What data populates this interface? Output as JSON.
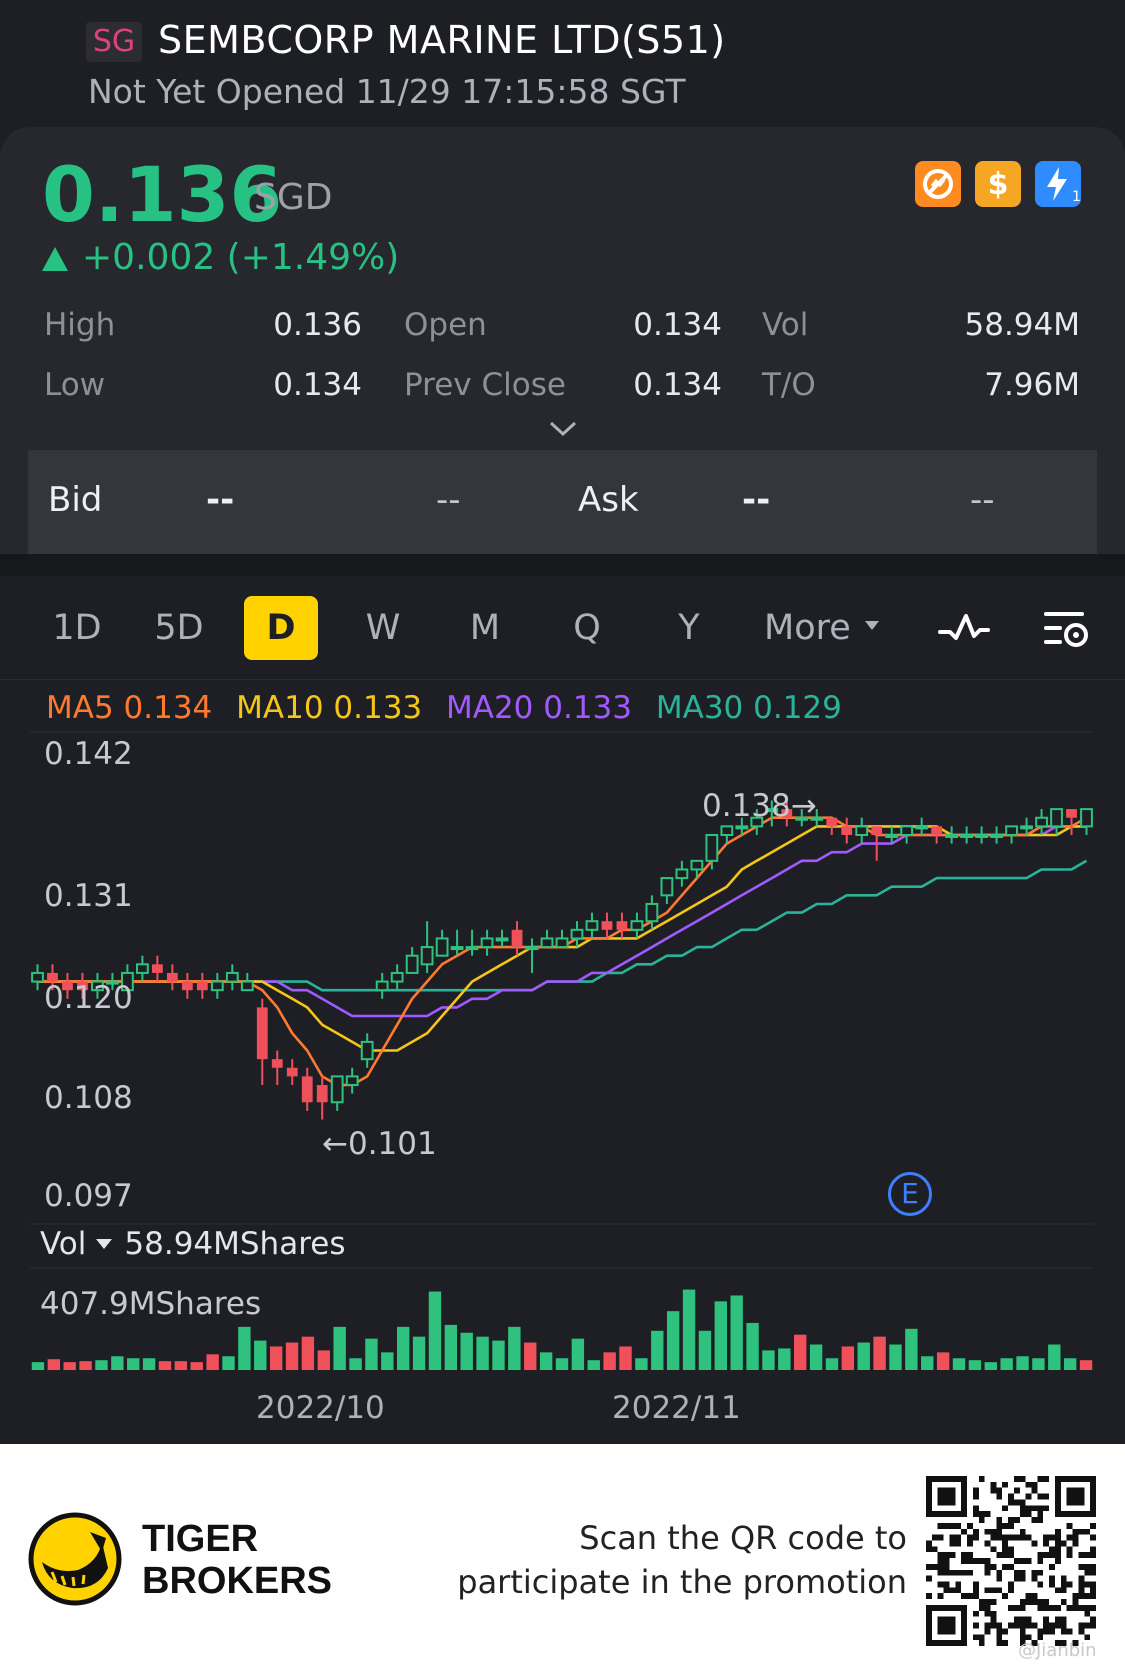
{
  "header": {
    "market_badge": "SG",
    "title": "SEMBCORP MARINE LTD(S51)",
    "status": "Not Yet Opened 11/29 17:15:58 SGT"
  },
  "quote": {
    "price": "0.136",
    "currency": "SGD",
    "change": "+0.002 (+1.49%)",
    "stats": {
      "high_label": "High",
      "high": "0.136",
      "low_label": "Low",
      "low": "0.134",
      "open_label": "Open",
      "open": "0.134",
      "prev_close_label": "Prev Close",
      "prev_close": "0.134",
      "vol_label": "Vol",
      "vol": "58.94M",
      "turnover_label": "T/O",
      "turnover": "7.96M"
    },
    "icons": [
      "no-short-sell-icon",
      "dividend-dollar-icon",
      "flash-order-icon"
    ]
  },
  "bid_ask": {
    "bid_label": "Bid",
    "bid_price": "--",
    "bid_size": "--",
    "ask_label": "Ask",
    "ask_price": "--",
    "ask_size": "--"
  },
  "period_tabs": {
    "items": [
      "1D",
      "5D",
      "D",
      "W",
      "M",
      "Q",
      "Y"
    ],
    "active": "D",
    "more_label": "More"
  },
  "indicators": {
    "ma5": "MA5 0.134",
    "ma10": "MA10 0.133",
    "ma20": "MA20 0.133",
    "ma30": "MA30 0.129",
    "colors": {
      "ma5": "#ff7a2f",
      "ma10": "#f5c518",
      "ma20": "#a259ff",
      "ma30": "#2bb39a",
      "up": "#2ec27e",
      "down": "#f0505a"
    }
  },
  "chart_data": {
    "type": "candlestick",
    "y_ticks": [
      "0.142",
      "0.131",
      "0.120",
      "0.108",
      "0.097"
    ],
    "ylim": [
      0.097,
      0.142
    ],
    "x_labels": [
      "2022/10",
      "2022/11"
    ],
    "high_annotation": "0.138",
    "low_annotation": "0.101",
    "earnings_marker": "E",
    "candles": [
      {
        "o": 0.117,
        "c": 0.118,
        "h": 0.119,
        "l": 0.116
      },
      {
        "o": 0.118,
        "c": 0.117,
        "h": 0.119,
        "l": 0.116
      },
      {
        "o": 0.117,
        "c": 0.116,
        "h": 0.118,
        "l": 0.115
      },
      {
        "o": 0.117,
        "c": 0.116,
        "h": 0.118,
        "l": 0.115
      },
      {
        "o": 0.116,
        "c": 0.117,
        "h": 0.118,
        "l": 0.115
      },
      {
        "o": 0.117,
        "c": 0.117,
        "h": 0.118,
        "l": 0.116
      },
      {
        "o": 0.116,
        "c": 0.118,
        "h": 0.119,
        "l": 0.116
      },
      {
        "o": 0.118,
        "c": 0.119,
        "h": 0.12,
        "l": 0.117
      },
      {
        "o": 0.119,
        "c": 0.118,
        "h": 0.12,
        "l": 0.117
      },
      {
        "o": 0.118,
        "c": 0.117,
        "h": 0.119,
        "l": 0.116
      },
      {
        "o": 0.117,
        "c": 0.116,
        "h": 0.118,
        "l": 0.115
      },
      {
        "o": 0.117,
        "c": 0.116,
        "h": 0.118,
        "l": 0.115
      },
      {
        "o": 0.116,
        "c": 0.117,
        "h": 0.118,
        "l": 0.115
      },
      {
        "o": 0.117,
        "c": 0.118,
        "h": 0.119,
        "l": 0.116
      },
      {
        "o": 0.116,
        "c": 0.117,
        "h": 0.118,
        "l": 0.116
      },
      {
        "o": 0.114,
        "c": 0.108,
        "h": 0.115,
        "l": 0.105
      },
      {
        "o": 0.108,
        "c": 0.107,
        "h": 0.109,
        "l": 0.105
      },
      {
        "o": 0.107,
        "c": 0.106,
        "h": 0.108,
        "l": 0.105
      },
      {
        "o": 0.106,
        "c": 0.103,
        "h": 0.107,
        "l": 0.102
      },
      {
        "o": 0.105,
        "c": 0.103,
        "h": 0.106,
        "l": 0.101
      },
      {
        "o": 0.103,
        "c": 0.106,
        "h": 0.106,
        "l": 0.102
      },
      {
        "o": 0.105,
        "c": 0.106,
        "h": 0.107,
        "l": 0.104
      },
      {
        "o": 0.108,
        "c": 0.11,
        "h": 0.111,
        "l": 0.107
      },
      {
        "o": 0.116,
        "c": 0.117,
        "h": 0.118,
        "l": 0.115
      },
      {
        "o": 0.117,
        "c": 0.118,
        "h": 0.119,
        "l": 0.116
      },
      {
        "o": 0.118,
        "c": 0.12,
        "h": 0.121,
        "l": 0.118
      },
      {
        "o": 0.119,
        "c": 0.121,
        "h": 0.124,
        "l": 0.118
      },
      {
        "o": 0.12,
        "c": 0.122,
        "h": 0.123,
        "l": 0.12
      },
      {
        "o": 0.121,
        "c": 0.121,
        "h": 0.123,
        "l": 0.12
      },
      {
        "o": 0.121,
        "c": 0.121,
        "h": 0.123,
        "l": 0.12
      },
      {
        "o": 0.121,
        "c": 0.122,
        "h": 0.123,
        "l": 0.12
      },
      {
        "o": 0.122,
        "c": 0.122,
        "h": 0.123,
        "l": 0.121
      },
      {
        "o": 0.123,
        "c": 0.121,
        "h": 0.124,
        "l": 0.12
      },
      {
        "o": 0.121,
        "c": 0.121,
        "h": 0.122,
        "l": 0.118
      },
      {
        "o": 0.121,
        "c": 0.122,
        "h": 0.123,
        "l": 0.121
      },
      {
        "o": 0.121,
        "c": 0.122,
        "h": 0.123,
        "l": 0.121
      },
      {
        "o": 0.122,
        "c": 0.123,
        "h": 0.124,
        "l": 0.121
      },
      {
        "o": 0.123,
        "c": 0.124,
        "h": 0.125,
        "l": 0.122
      },
      {
        "o": 0.124,
        "c": 0.123,
        "h": 0.125,
        "l": 0.122
      },
      {
        "o": 0.124,
        "c": 0.123,
        "h": 0.125,
        "l": 0.122
      },
      {
        "o": 0.123,
        "c": 0.124,
        "h": 0.125,
        "l": 0.122
      },
      {
        "o": 0.124,
        "c": 0.126,
        "h": 0.127,
        "l": 0.123
      },
      {
        "o": 0.127,
        "c": 0.129,
        "h": 0.129,
        "l": 0.126
      },
      {
        "o": 0.129,
        "c": 0.13,
        "h": 0.131,
        "l": 0.128
      },
      {
        "o": 0.13,
        "c": 0.131,
        "h": 0.131,
        "l": 0.129
      },
      {
        "o": 0.131,
        "c": 0.134,
        "h": 0.134,
        "l": 0.13
      },
      {
        "o": 0.134,
        "c": 0.135,
        "h": 0.135,
        "l": 0.133
      },
      {
        "o": 0.135,
        "c": 0.135,
        "h": 0.136,
        "l": 0.134
      },
      {
        "o": 0.135,
        "c": 0.136,
        "h": 0.137,
        "l": 0.134
      },
      {
        "o": 0.137,
        "c": 0.137,
        "h": 0.138,
        "l": 0.135
      },
      {
        "o": 0.137,
        "c": 0.136,
        "h": 0.138,
        "l": 0.135
      },
      {
        "o": 0.136,
        "c": 0.136,
        "h": 0.137,
        "l": 0.135
      },
      {
        "o": 0.136,
        "c": 0.136,
        "h": 0.137,
        "l": 0.135
      },
      {
        "o": 0.136,
        "c": 0.135,
        "h": 0.136,
        "l": 0.134
      },
      {
        "o": 0.135,
        "c": 0.134,
        "h": 0.136,
        "l": 0.133
      },
      {
        "o": 0.134,
        "c": 0.135,
        "h": 0.136,
        "l": 0.133
      },
      {
        "o": 0.135,
        "c": 0.134,
        "h": 0.135,
        "l": 0.131
      },
      {
        "o": 0.134,
        "c": 0.134,
        "h": 0.135,
        "l": 0.133
      },
      {
        "o": 0.134,
        "c": 0.135,
        "h": 0.135,
        "l": 0.133
      },
      {
        "o": 0.135,
        "c": 0.135,
        "h": 0.136,
        "l": 0.134
      },
      {
        "o": 0.135,
        "c": 0.134,
        "h": 0.135,
        "l": 0.133
      },
      {
        "o": 0.134,
        "c": 0.134,
        "h": 0.135,
        "l": 0.133
      },
      {
        "o": 0.134,
        "c": 0.134,
        "h": 0.135,
        "l": 0.133
      },
      {
        "o": 0.134,
        "c": 0.134,
        "h": 0.135,
        "l": 0.133
      },
      {
        "o": 0.134,
        "c": 0.134,
        "h": 0.135,
        "l": 0.133
      },
      {
        "o": 0.134,
        "c": 0.135,
        "h": 0.135,
        "l": 0.133
      },
      {
        "o": 0.135,
        "c": 0.135,
        "h": 0.136,
        "l": 0.134
      },
      {
        "o": 0.135,
        "c": 0.136,
        "h": 0.137,
        "l": 0.134
      },
      {
        "o": 0.135,
        "c": 0.137,
        "h": 0.137,
        "l": 0.134
      },
      {
        "o": 0.137,
        "c": 0.136,
        "h": 0.137,
        "l": 0.134
      },
      {
        "o": 0.135,
        "c": 0.137,
        "h": 0.137,
        "l": 0.134
      }
    ],
    "ma": {
      "ma5": [
        0.117,
        0.117,
        0.117,
        0.117,
        0.117,
        0.117,
        0.117,
        0.117,
        0.117,
        0.117,
        0.117,
        0.117,
        0.117,
        0.117,
        0.117,
        0.116,
        0.114,
        0.111,
        0.109,
        0.106,
        0.105,
        0.105,
        0.106,
        0.109,
        0.112,
        0.115,
        0.117,
        0.119,
        0.12,
        0.121,
        0.121,
        0.121,
        0.121,
        0.121,
        0.121,
        0.121,
        0.122,
        0.122,
        0.122,
        0.123,
        0.123,
        0.124,
        0.125,
        0.127,
        0.129,
        0.131,
        0.133,
        0.134,
        0.135,
        0.136,
        0.136,
        0.136,
        0.136,
        0.136,
        0.135,
        0.135,
        0.134,
        0.134,
        0.134,
        0.134,
        0.134,
        0.134,
        0.134,
        0.134,
        0.134,
        0.134,
        0.134,
        0.135,
        0.135,
        0.135,
        0.136
      ],
      "ma10": [
        0.117,
        0.117,
        0.117,
        0.117,
        0.117,
        0.117,
        0.117,
        0.117,
        0.117,
        0.117,
        0.117,
        0.117,
        0.117,
        0.117,
        0.117,
        0.117,
        0.116,
        0.115,
        0.114,
        0.112,
        0.111,
        0.11,
        0.109,
        0.109,
        0.109,
        0.11,
        0.111,
        0.113,
        0.115,
        0.117,
        0.118,
        0.119,
        0.12,
        0.121,
        0.121,
        0.121,
        0.121,
        0.122,
        0.122,
        0.122,
        0.122,
        0.123,
        0.124,
        0.125,
        0.126,
        0.127,
        0.128,
        0.13,
        0.131,
        0.132,
        0.133,
        0.134,
        0.135,
        0.135,
        0.135,
        0.135,
        0.135,
        0.135,
        0.135,
        0.135,
        0.135,
        0.134,
        0.134,
        0.134,
        0.134,
        0.134,
        0.134,
        0.134,
        0.134,
        0.135,
        0.135
      ],
      "ma20": [
        0.117,
        0.117,
        0.117,
        0.117,
        0.117,
        0.117,
        0.117,
        0.117,
        0.117,
        0.117,
        0.117,
        0.117,
        0.117,
        0.117,
        0.117,
        0.117,
        0.117,
        0.116,
        0.116,
        0.115,
        0.114,
        0.113,
        0.113,
        0.113,
        0.113,
        0.113,
        0.113,
        0.114,
        0.114,
        0.115,
        0.115,
        0.116,
        0.116,
        0.116,
        0.117,
        0.117,
        0.117,
        0.118,
        0.118,
        0.119,
        0.12,
        0.121,
        0.122,
        0.123,
        0.124,
        0.125,
        0.126,
        0.127,
        0.128,
        0.129,
        0.13,
        0.131,
        0.131,
        0.132,
        0.132,
        0.133,
        0.133,
        0.133,
        0.134,
        0.134,
        0.134,
        0.134,
        0.134,
        0.134,
        0.134,
        0.134,
        0.134,
        0.134,
        0.135,
        0.135,
        0.135
      ],
      "ma30": [
        0.117,
        0.117,
        0.117,
        0.117,
        0.117,
        0.117,
        0.117,
        0.117,
        0.117,
        0.117,
        0.117,
        0.117,
        0.117,
        0.117,
        0.117,
        0.117,
        0.117,
        0.117,
        0.117,
        0.116,
        0.116,
        0.116,
        0.116,
        0.116,
        0.116,
        0.116,
        0.116,
        0.116,
        0.116,
        0.116,
        0.116,
        0.116,
        0.116,
        0.116,
        0.117,
        0.117,
        0.117,
        0.117,
        0.118,
        0.118,
        0.119,
        0.119,
        0.12,
        0.12,
        0.121,
        0.121,
        0.122,
        0.123,
        0.123,
        0.124,
        0.125,
        0.125,
        0.126,
        0.126,
        0.127,
        0.127,
        0.127,
        0.128,
        0.128,
        0.128,
        0.129,
        0.129,
        0.129,
        0.129,
        0.129,
        0.129,
        0.129,
        0.13,
        0.13,
        0.13,
        0.131
      ]
    },
    "volume": {
      "label": "Vol",
      "current": "58.94MShares",
      "max_label": "407.9MShares",
      "max": 407.9,
      "values": [
        40,
        55,
        40,
        45,
        50,
        70,
        60,
        60,
        45,
        45,
        40,
        80,
        70,
        220,
        150,
        120,
        140,
        170,
        100,
        220,
        60,
        160,
        90,
        220,
        170,
        400,
        230,
        190,
        170,
        150,
        220,
        140,
        90,
        60,
        160,
        50,
        90,
        120,
        60,
        200,
        300,
        410,
        200,
        350,
        380,
        240,
        100,
        110,
        180,
        130,
        60,
        120,
        140,
        170,
        130,
        210,
        70,
        90,
        60,
        50,
        40,
        60,
        70,
        60,
        130,
        60,
        50
      ]
    }
  },
  "footer": {
    "brand_line1": "TIGER",
    "brand_line2": "BROKERS",
    "promo_line1": "Scan the QR code to",
    "promo_line2": "participate in the promotion",
    "watermark": "@Jianbin"
  }
}
